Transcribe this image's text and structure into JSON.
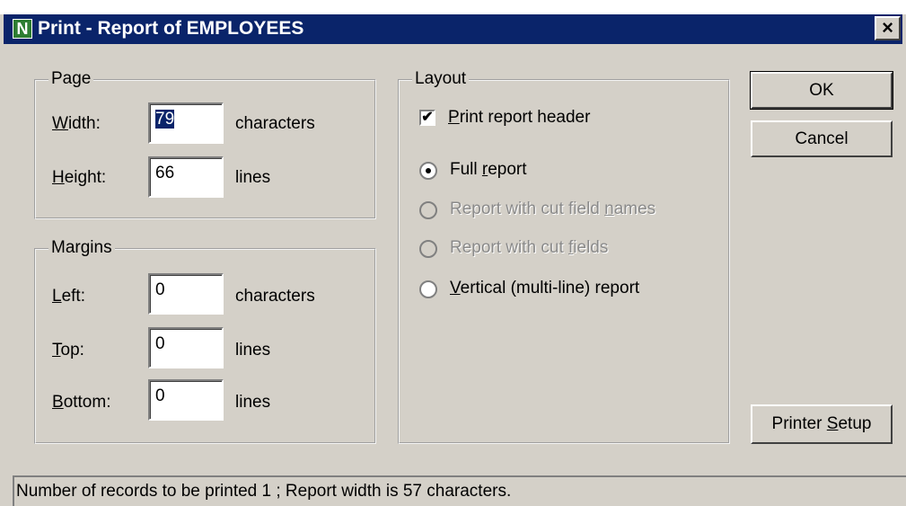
{
  "window": {
    "title": "Print - Report of EMPLOYEES",
    "icon_letter": "N",
    "close_glyph": "×"
  },
  "page": {
    "legend": "Page",
    "width_label": "Width:",
    "width_value": "79",
    "width_unit": "characters",
    "height_label": "Height:",
    "height_value": "66",
    "height_unit": "lines"
  },
  "margins": {
    "legend": "Margins",
    "left_label": "Left:",
    "left_value": "0",
    "left_unit": "characters",
    "top_label": "Top:",
    "top_value": "0",
    "top_unit": "lines",
    "bottom_label": "Bottom:",
    "bottom_value": "0",
    "bottom_unit": "lines"
  },
  "layout": {
    "legend": "Layout",
    "print_header_label": "Print report header",
    "print_header_checked": true,
    "options": [
      {
        "label": "Full report",
        "selected": true,
        "enabled": true
      },
      {
        "label": "Report with cut field names",
        "selected": false,
        "enabled": false
      },
      {
        "label": "Report with cut fields",
        "selected": false,
        "enabled": false
      },
      {
        "label": "Vertical (multi-line) report",
        "selected": false,
        "enabled": true
      }
    ]
  },
  "buttons": {
    "ok": "OK",
    "cancel": "Cancel",
    "printer_setup": "Printer Setup"
  },
  "status": "Number of records to be printed 1  ;  Report width is 57 characters.",
  "colors": {
    "title_bar": "#0a246a",
    "dialog_bg": "#d4d0c8",
    "selection": "#0a246a"
  }
}
